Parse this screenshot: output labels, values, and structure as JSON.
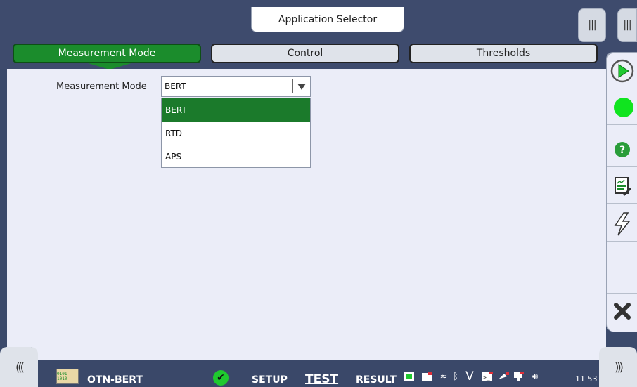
{
  "header": {
    "app_selector_label": "Application Selector",
    "menu_handle_glyph": "|||"
  },
  "tabs": [
    {
      "label": "Measurement Mode"
    },
    {
      "label": "Control"
    },
    {
      "label": "Thresholds"
    }
  ],
  "form": {
    "measurement_mode_label": "Measurement Mode",
    "measurement_mode_value": "BERT",
    "options": [
      "BERT",
      "RTD",
      "APS"
    ]
  },
  "sidebar": {
    "icons": [
      "play-icon",
      "status-led-icon",
      "help-icon",
      "report-icon",
      "lightning-icon",
      "close-icon"
    ]
  },
  "status": {
    "app_name": "OTN-BERT",
    "setup_label": "SETUP",
    "test_label": "TEST",
    "result_label": "RESULT",
    "time": "11 53",
    "left_arrows": "(((",
    "right_arrows": ")))",
    "icon_text": "0101 1010"
  },
  "colors": {
    "accent_green": "#1b8c2c",
    "status_ok": "#1fc92f",
    "bar_bg": "#3e4b6d"
  }
}
